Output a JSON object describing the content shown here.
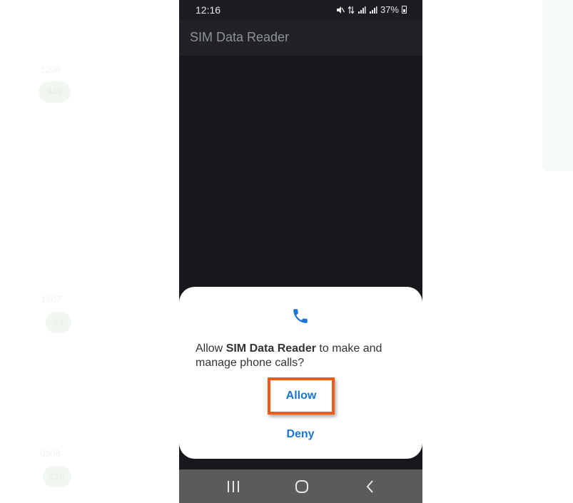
{
  "background": {
    "items": [
      {
        "label": "1208",
        "badge": "949"
      },
      {
        "label": "1307",
        "badge": "33"
      },
      {
        "label": "0908",
        "badge": "116"
      }
    ]
  },
  "status_bar": {
    "time": "12:16",
    "battery": "37%",
    "icons": [
      "mute-icon",
      "data-arrows-icon",
      "signal-icon",
      "signal-icon",
      "battery-icon"
    ]
  },
  "app_bar": {
    "title": "SIM Data Reader"
  },
  "dialog": {
    "icon": "phone-icon",
    "message_prefix": "Allow ",
    "app_name": "SIM Data Reader",
    "message_suffix": " to make and manage phone calls?",
    "allow_label": "Allow",
    "deny_label": "Deny"
  },
  "nav_bar": {
    "buttons": [
      "recents-icon",
      "home-icon",
      "back-icon"
    ]
  },
  "colors": {
    "accent": "#1a74d2",
    "highlight": "#f05a14",
    "phone_bg": "#16181c",
    "nav_bg": "#5b5b5b"
  }
}
